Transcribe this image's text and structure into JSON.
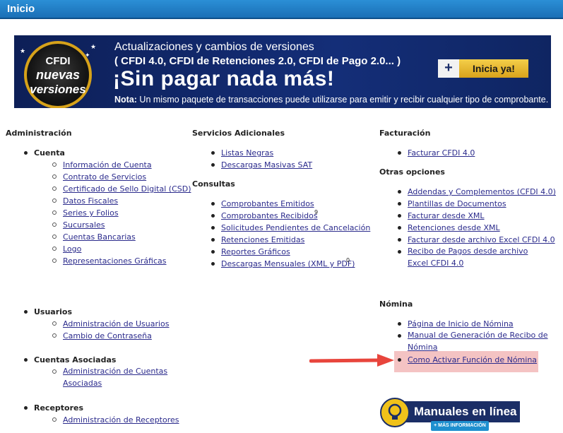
{
  "header": {
    "title": "Inicio"
  },
  "banner": {
    "seal_line1": "CFDI",
    "seal_line2": "nuevas",
    "seal_line3": "versiones",
    "line1": "Actualizaciones y cambios de versiones",
    "line2": "( CFDI 4.0, CFDI de Retenciones 2.0, CFDI de Pago 2.0... )",
    "headline": "¡Sin pagar nada más!",
    "note_label": "Nota:",
    "note_text": " Un mismo paquete de transacciones puede utilizarse para emitir y recibir cualquier tipo de comprobante.",
    "cta_plus": "+",
    "cta_label": "Inicia ya!",
    "colors": {
      "background": "#142e78",
      "accent": "#d6a21a"
    }
  },
  "administracion": {
    "title": "Administración",
    "cuenta": {
      "label": "Cuenta",
      "links": [
        "Información de Cuenta",
        "Contrato de Servicios",
        "Certificado de Sello Digital (CSD)",
        "Datos Fiscales",
        "Series y Folios",
        "Sucursales",
        "Cuentas Bancarias",
        "Logo",
        "Representaciones Gráficas"
      ]
    },
    "usuarios": {
      "label": "Usuarios",
      "links": [
        "Administración de Usuarios",
        "Cambio de Contraseña"
      ]
    },
    "asociadas": {
      "label": "Cuentas Asociadas",
      "links": [
        "Administración de Cuentas Asociadas"
      ]
    },
    "receptores": {
      "label": "Receptores",
      "links": [
        "Administración de Receptores"
      ]
    }
  },
  "servicios": {
    "title": "Servicios Adicionales",
    "links": [
      "Listas Negras",
      "Descargas Masivas SAT"
    ]
  },
  "consultas": {
    "title": "Consultas",
    "links": [
      "Comprobantes Emitidos",
      "Comprobantes Recibidos",
      "Solicitudes Pendientes de Cancelación",
      "Retenciones Emitidas",
      "Reportes Gráficos",
      "Descargas Mensuales (XML y PDF)"
    ],
    "recibidos_count": "9",
    "descargas_count": "0"
  },
  "facturacion": {
    "title": "Facturación",
    "links": [
      "Facturar CFDI 4.0"
    ]
  },
  "otras": {
    "title": "Otras opciones",
    "links": [
      "Addendas y Complementos (CFDI 4.0)",
      "Plantillas de Documentos",
      "Facturar desde XML",
      "Retenciones desde XML",
      "Facturar desde archivo Excel CFDI 4.0",
      "Recibo de Pagos desde archivo Excel CFDI 4.0"
    ]
  },
  "nomina": {
    "title": "Nómina",
    "links": [
      "Página de Inicio de Nómina",
      "Manual de Generación de Recibo de Nómina",
      "Como Activar Función de Nómina"
    ]
  },
  "manuales": {
    "label": "Manuales en línea",
    "more": "+ MÁS INFORMACIÓN"
  },
  "colors": {
    "link": "#2b2b8c",
    "topbar": "#1a6fb6",
    "highlight": "#f4c3c3",
    "arrow": "#e8453c"
  }
}
